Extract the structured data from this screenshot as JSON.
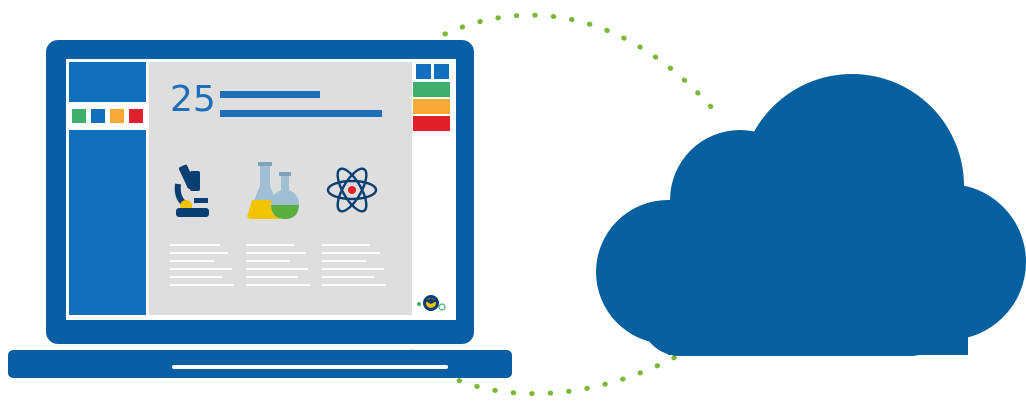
{
  "dashboard": {
    "big_number": "25"
  },
  "colors": {
    "laptop_frame": "#0a5ea3",
    "sidebar": "#1170bd",
    "content_bg": "#dedede",
    "accent_blue": "#1f6fb8",
    "green": "#3db06b",
    "orange": "#f6a935",
    "red": "#e0202a",
    "cloud": "#06609f",
    "dotted_ring": "#7ab838"
  },
  "icons": {
    "microscope": "microscope-icon",
    "flasks": "flasks-icon",
    "atom": "atom-icon",
    "brand": "graduation-brand-icon",
    "cloud": "cloud-icon"
  }
}
